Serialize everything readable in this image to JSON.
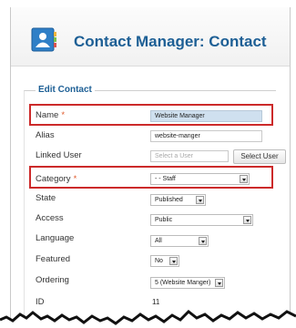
{
  "header": {
    "title": "Contact Manager: Contact",
    "icon": "contact-card-icon"
  },
  "form": {
    "legend": "Edit Contact",
    "name_label": "Name",
    "name_required": "*",
    "name_value": "Website Manager",
    "alias_label": "Alias",
    "alias_value": "website-manger",
    "linked_user_label": "Linked User",
    "linked_user_placeholder": "Select a User",
    "select_user_button": "Select User",
    "category_label": "Category",
    "category_required": "*",
    "category_value": "- - Staff",
    "state_label": "State",
    "state_value": "Published",
    "access_label": "Access",
    "access_value": "Public",
    "language_label": "Language",
    "language_value": "All",
    "featured_label": "Featured",
    "featured_value": "No",
    "ordering_label": "Ordering",
    "ordering_value": "5 (Website Manger)",
    "id_label": "ID",
    "id_value": "11"
  },
  "colors": {
    "highlight_border": "#cc2a2a",
    "title": "#1d5f95"
  }
}
